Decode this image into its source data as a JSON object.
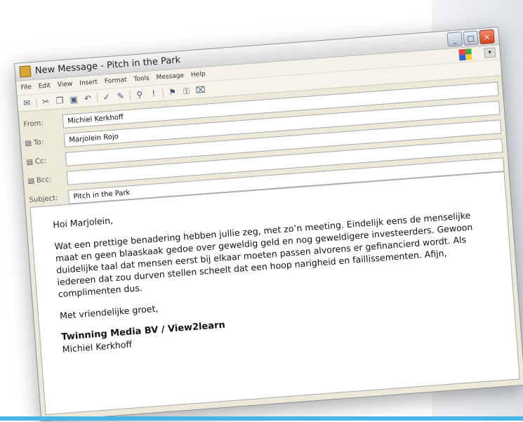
{
  "window": {
    "title": "New Message - Pitch in the Park",
    "controls": [
      "_",
      "□",
      "×"
    ]
  },
  "menu": [
    "File",
    "Edit",
    "View",
    "Insert",
    "Format",
    "Tools",
    "Message",
    "Help"
  ],
  "fields": {
    "from_label": "From:",
    "from_value": "Michiel Kerkhoff",
    "to_label": "To:",
    "to_value": "Marjolein Rojo",
    "cc_label": "Cc:",
    "cc_value": "",
    "bcc_label": "Bcc:",
    "bcc_value": "",
    "subject_label": "Subject:",
    "subject_value": "Pitch in the Park"
  },
  "body": {
    "greeting": "Hoi Marjolein,",
    "paragraph": "Wat een prettige benadering hebben jullie zeg, met zo’n meeting. Eindelijk eens de menselijke maat en geen blaaskaak gedoe over geweldig geld en nog geweldigere investeerders. Gewoon duidelijke taal dat mensen eerst bij elkaar moeten passen alvorens er gefinancierd wordt. Als iedereen dat zou durven stellen scheelt dat een hoop narigheid en faillissementen. Afijn, complimenten dus.",
    "closing": "Met vriendelijke groet,",
    "company": "Twinning Media BV / View2learn",
    "name": "Michiel Kerkhoff"
  }
}
